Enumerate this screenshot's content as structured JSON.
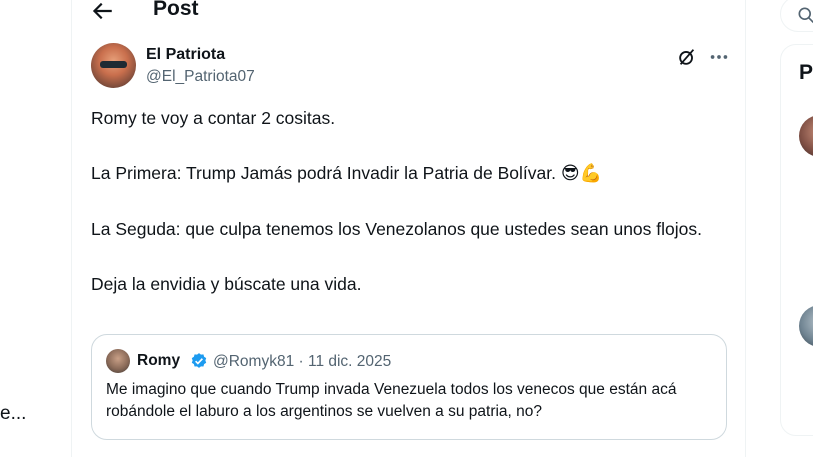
{
  "left_nav": {
    "truncated_text": "e..."
  },
  "header": {
    "title": "Post"
  },
  "post": {
    "author_name": "El Patriota",
    "author_handle": "@El_Patriota07",
    "body": {
      "line1": "Romy te voy a contar 2 cositas.",
      "line2": " La Primera: Trump Jamás podrá Invadir la Patria de Bolívar.",
      "line2_emoji": "😎💪",
      "line3": "La Seguda: que culpa tenemos los Venezolanos que ustedes sean unos flojos.",
      "line4": "Deja la envidia y búscate una vida."
    },
    "quoted": {
      "name": "Romy",
      "handle_date": "@Romyk81 · 11 dic. 2025",
      "text": "Me imagino que cuando Trump invada Venezuela todos los venecos que están acá robándole el laburo a los argentinos se vuelven a su patria, no?"
    }
  },
  "sidebar": {
    "heading": "P"
  },
  "colors": {
    "text": "#0f1419",
    "secondary": "#536471",
    "border": "#cfd9de",
    "verified": "#1d9bf0"
  }
}
